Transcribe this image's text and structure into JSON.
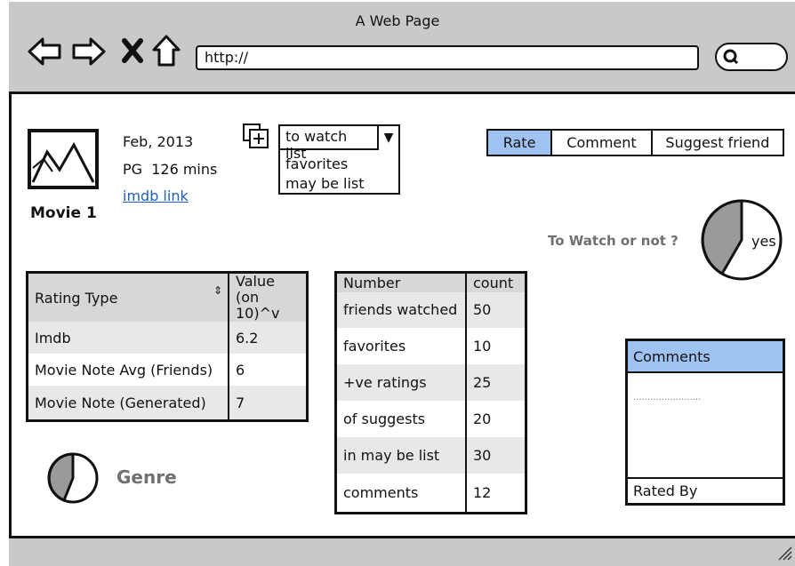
{
  "window": {
    "title": "A Web Page",
    "url": "http://"
  },
  "movie": {
    "title": "Movie 1",
    "date": "Feb, 2013",
    "rating_runtime": "PG  126 mins",
    "link": "imdb link"
  },
  "list_dropdown": {
    "selected": "to watch list",
    "options": [
      "favorites",
      "may be list"
    ]
  },
  "action_tabs": {
    "items": [
      "Rate",
      "Comment",
      "Suggest friend"
    ],
    "selected": "Rate"
  },
  "decision": {
    "label": "To Watch or not ?",
    "pie_label": "yes"
  },
  "ratings_table": {
    "headers": [
      "Rating Type",
      "Value\n(on 10)^v"
    ],
    "rows": [
      {
        "type": "Imdb",
        "value": "6.2"
      },
      {
        "type": "Movie Note Avg (Friends)",
        "value": "6"
      },
      {
        "type": "Movie Note (Generated)",
        "value": "7"
      }
    ]
  },
  "stats_table": {
    "headers": [
      "Number",
      "count"
    ],
    "rows": [
      {
        "label": "friends watched",
        "count": "50"
      },
      {
        "label": "favorites",
        "count": "10"
      },
      {
        "label": "+ve ratings",
        "count": "25"
      },
      {
        "label": "of suggests",
        "count": "20"
      },
      {
        "label": "in may be list",
        "count": "30"
      },
      {
        "label": "comments",
        "count": "12"
      }
    ]
  },
  "genre": {
    "label": "Genre"
  },
  "comments": {
    "header": "Comments",
    "placeholder": "........................",
    "footer": "Rated By"
  },
  "icons": [
    "back-arrow-icon",
    "forward-arrow-icon",
    "close-icon",
    "home-icon",
    "search-icon",
    "image-placeholder-icon",
    "add-to-list-icon",
    "dropdown-arrow-icon"
  ]
}
